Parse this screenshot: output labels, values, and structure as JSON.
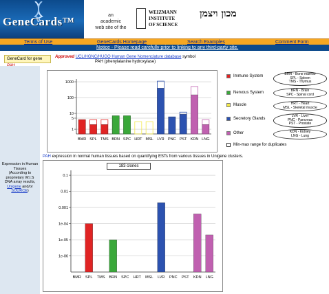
{
  "header": {
    "logo_text": "GeneCards™",
    "academic_lines": [
      "an",
      "academic",
      "web site of the"
    ],
    "weizmann_lines": [
      "WEIZMANN",
      "INSTITUTE",
      "OF SCIENCE"
    ],
    "hebrew": "מכון ויצמן"
  },
  "nav": {
    "items": [
      {
        "label": "Terms of Use"
      },
      {
        "label": "GeneCards Homepage"
      },
      {
        "label": "Search Examples"
      },
      {
        "label": "Comment Form"
      }
    ],
    "notice": "Notice - Please read carefully prior to linking to any third-party site."
  },
  "gene": {
    "prefix": "GeneCard",
    "for": "for gene",
    "symbol": "PAH",
    "approved": "Approved",
    "link": "UCL/HGNC/HUGO Human Gene Nomenclature database",
    "suffix": "symbol",
    "name": "PAH (phenylalanine hydroxylase)"
  },
  "expression": {
    "label": "Expression in Human Tissues",
    "note": "(According to proprietary W.I.S DNA array results,",
    "link1": "Unigene",
    "and": "and/or",
    "link2": "SOURCE",
    "close": ")"
  },
  "colors": {
    "immune": "#e02424",
    "nervous": "#3aa83a",
    "muscle": "#f2e84a",
    "secretory": "#2c52b0",
    "other": "#c060b0",
    "header_blue": "#0c4a8c",
    "nav_orange": "#f6a722"
  },
  "legend": [
    {
      "key": "immune",
      "label": "Immune System",
      "desc": [
        "BMR - Bone marrow",
        "SPL - Spleen",
        "TMS - Thymus"
      ]
    },
    {
      "key": "nervous",
      "label": "Nervous System",
      "desc": [
        "BRN - Brain",
        "SPC - Spinal cord"
      ]
    },
    {
      "key": "muscle",
      "label": "Muscle",
      "desc": [
        "HRT - Heart",
        "MSL - Skeletal muscle"
      ]
    },
    {
      "key": "secretory",
      "label": "Secretory Glands",
      "desc": [
        "LVR - Liver",
        "PNC - Pancreas",
        "PST - Prostate"
      ]
    },
    {
      "key": "other",
      "label": "Other",
      "desc": [
        "KDN - Kidney",
        "LNG - Lung"
      ]
    }
  ],
  "legend_minmax": "Min-max range for duplicates",
  "caption": {
    "gene": "PAH",
    "text": "expression in normal human tissues based on quantifying ESTs from various tissues in Unigene clusters."
  },
  "clones_label": "183 clones",
  "chart_data": [
    {
      "type": "bar",
      "title": "",
      "scale": "log",
      "ylim": [
        0.5,
        1500
      ],
      "y_ticks": [
        {
          "v": 1,
          "label": "1"
        },
        {
          "v": 5,
          "label": "5"
        },
        {
          "v": 10,
          "label": "10"
        },
        {
          "v": 100,
          "label": "100"
        },
        {
          "v": 1000,
          "label": "1000"
        }
      ],
      "categories": [
        "BMR",
        "SPL",
        "TMS",
        "BRN",
        "SPC",
        "HRT",
        "MSL",
        "LVR",
        "PNC",
        "PST",
        "KDN",
        "LNG"
      ],
      "groups": [
        "immune",
        "immune",
        "immune",
        "nervous",
        "nervous",
        "muscle",
        "muscle",
        "secretory",
        "secretory",
        "secretory",
        "other",
        "other"
      ],
      "values": [
        4,
        2,
        2,
        7,
        7,
        0.5,
        0.5,
        400,
        6,
        9,
        150,
        2
      ],
      "max": [
        4,
        4,
        4,
        7,
        7,
        3,
        3,
        1100,
        6,
        12,
        500,
        4
      ]
    },
    {
      "type": "bar",
      "title": "",
      "scale": "log",
      "ylim": [
        1e-07,
        0.2
      ],
      "y_ticks": [
        {
          "v": 0.1,
          "label": "0.1"
        },
        {
          "v": 0.01,
          "label": "0.01"
        },
        {
          "v": 0.001,
          "label": "0.001"
        },
        {
          "v": 0.0001,
          "label": "1e-04"
        },
        {
          "v": 1e-05,
          "label": "1e-05"
        },
        {
          "v": 1e-06,
          "label": "1e-06"
        }
      ],
      "categories": [
        "BMR",
        "SPL",
        "TMS",
        "BRN",
        "SPC",
        "HRT",
        "MSL",
        "LVR",
        "PNC",
        "PST",
        "KDN",
        "LNG"
      ],
      "groups": [
        "immune",
        "immune",
        "immune",
        "nervous",
        "nervous",
        "muscle",
        "muscle",
        "secretory",
        "secretory",
        "secretory",
        "other",
        "other"
      ],
      "values": [
        null,
        0.0001,
        null,
        1e-05,
        null,
        null,
        null,
        0.002,
        null,
        null,
        0.0004,
        2e-05
      ]
    }
  ]
}
